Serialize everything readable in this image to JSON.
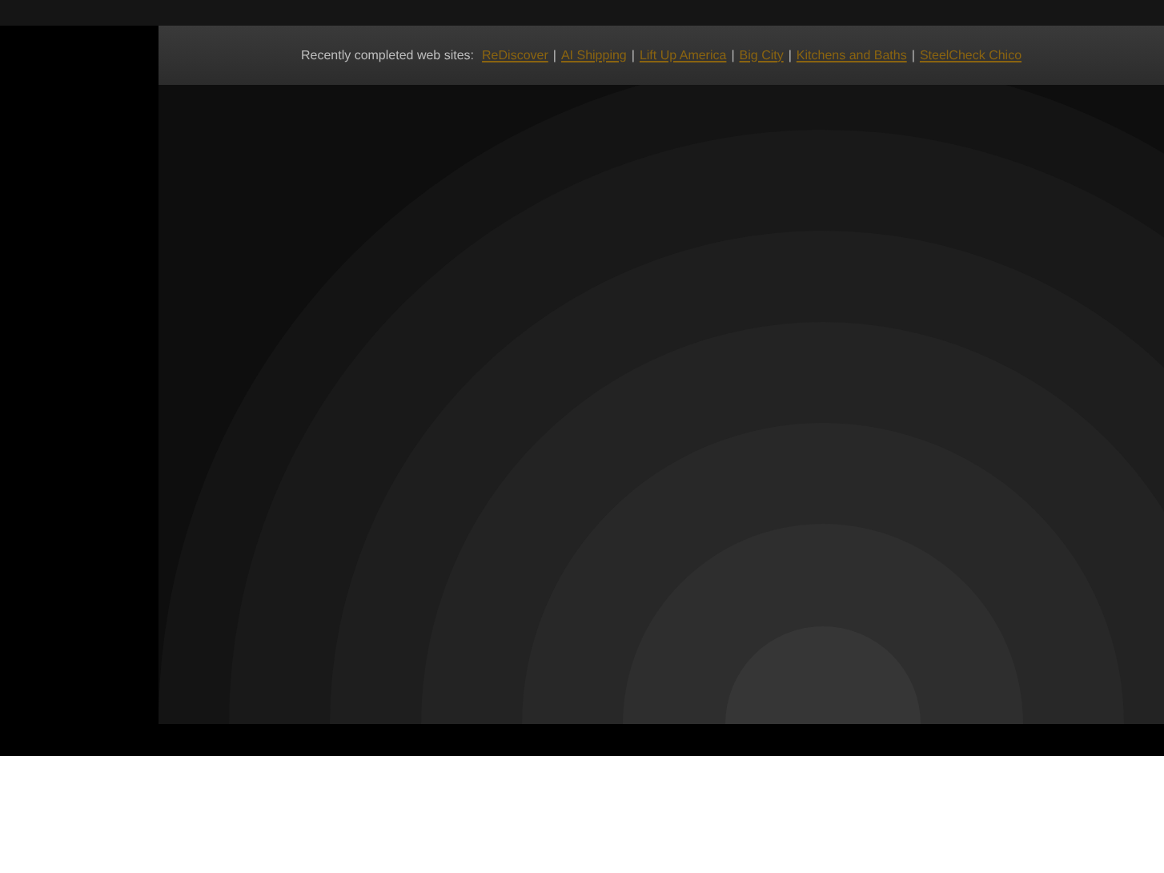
{
  "banner": {
    "label": "Recently completed web sites:",
    "links": [
      "ReDiscover",
      "AI Shipping",
      "Lift Up America",
      "Big City",
      "Kitchens and Baths",
      "SteelCheck Chico"
    ],
    "separator": "|"
  }
}
